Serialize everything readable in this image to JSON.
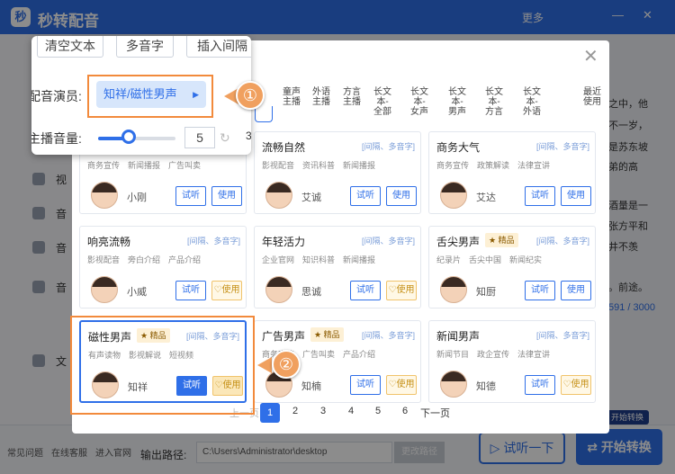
{
  "app": {
    "title": "秒转配音",
    "more": "更多",
    "logo": "秒"
  },
  "sidebar": [
    {
      "label": "视"
    },
    {
      "label": "音"
    },
    {
      "label": "音"
    },
    {
      "label": "音"
    },
    {
      "label": "文"
    }
  ],
  "right_text": [
    "之中，他",
    "不一岁，",
    "是苏东坡",
    "弟的高",
    "酒量是一",
    "张方平和",
    "井不羡",
    "。前途。",
    "591 / 3000"
  ],
  "bottom": {
    "items": [
      "常见问题",
      "在线客服",
      "进入官网"
    ],
    "output_label": "输出路径:",
    "output_path": "C:\\Users\\Administrator\\desktop",
    "change_path": "更改路径",
    "try_listen": "试听一下",
    "start": "开始转换",
    "start_badge": "开始转换"
  },
  "categories": [
    "童声主播",
    "外语主播",
    "方言主播",
    "长文本-全部",
    "长文本-女声",
    "长文本-男声",
    "长文本-方言",
    "长文本-外语",
    "最近使用"
  ],
  "cards": [
    {
      "name": "",
      "voice": "小刚",
      "tags": [
        "商务宣传",
        "新闻播报",
        "广告叫卖"
      ],
      "premium": false
    },
    {
      "name": "流畅自然",
      "voice": "艾诚",
      "tags": [
        "影视配音",
        "资讯科普",
        "新闻播报"
      ],
      "premium": false
    },
    {
      "name": "商务大气",
      "voice": "艾达",
      "tags": [
        "商务宣传",
        "政策解读",
        "法律宣讲"
      ],
      "premium": false
    },
    {
      "name": "响亮流畅",
      "voice": "小威",
      "tags": [
        "影视配音",
        "旁白介绍",
        "产品介绍"
      ],
      "premium": false
    },
    {
      "name": "年轻活力",
      "voice": "思诚",
      "tags": [
        "企业官网",
        "知识科普",
        "新闻播报"
      ],
      "premium": false
    },
    {
      "name": "舌尖男声",
      "voice": "知厨",
      "tags": [
        "纪录片",
        "舌尖中国",
        "新闻纪实"
      ],
      "premium": true
    },
    {
      "name": "磁性男声",
      "voice": "知祥",
      "tags": [
        "有声读物",
        "影视解说",
        "短视频"
      ],
      "premium": true
    },
    {
      "name": "广告男声",
      "voice": "知楠",
      "tags": [
        "商务宣传",
        "广告叫卖",
        "产品介绍"
      ],
      "premium": true
    },
    {
      "name": "新闻男声",
      "voice": "知德",
      "tags": [
        "新闻节目",
        "政企宣传",
        "法律宣讲"
      ],
      "premium": false
    }
  ],
  "card_tagline": "[间隔、多音字]",
  "premium_label": "★ 精品",
  "try_label": "试听",
  "use_label": "使用",
  "pager": {
    "prev": "上一页",
    "pages": [
      "1",
      "2",
      "3",
      "4",
      "5",
      "6"
    ],
    "next": "下一页"
  },
  "popup": {
    "btn_clear": "清空文本",
    "btn_poly": "多音字",
    "btn_pause": "插入间隔",
    "actor_label": "配音演员:",
    "actor_value": "知祥/磁性男声",
    "volume_label": "主播音量:",
    "volume_value": "5",
    "volume_level": 0.4,
    "volume_extra": "3"
  },
  "callouts": [
    "①",
    "②"
  ],
  "colors": {
    "accent": "#2f6fe8",
    "highlight": "#f28a3c",
    "premium": "#fdf0d5"
  }
}
